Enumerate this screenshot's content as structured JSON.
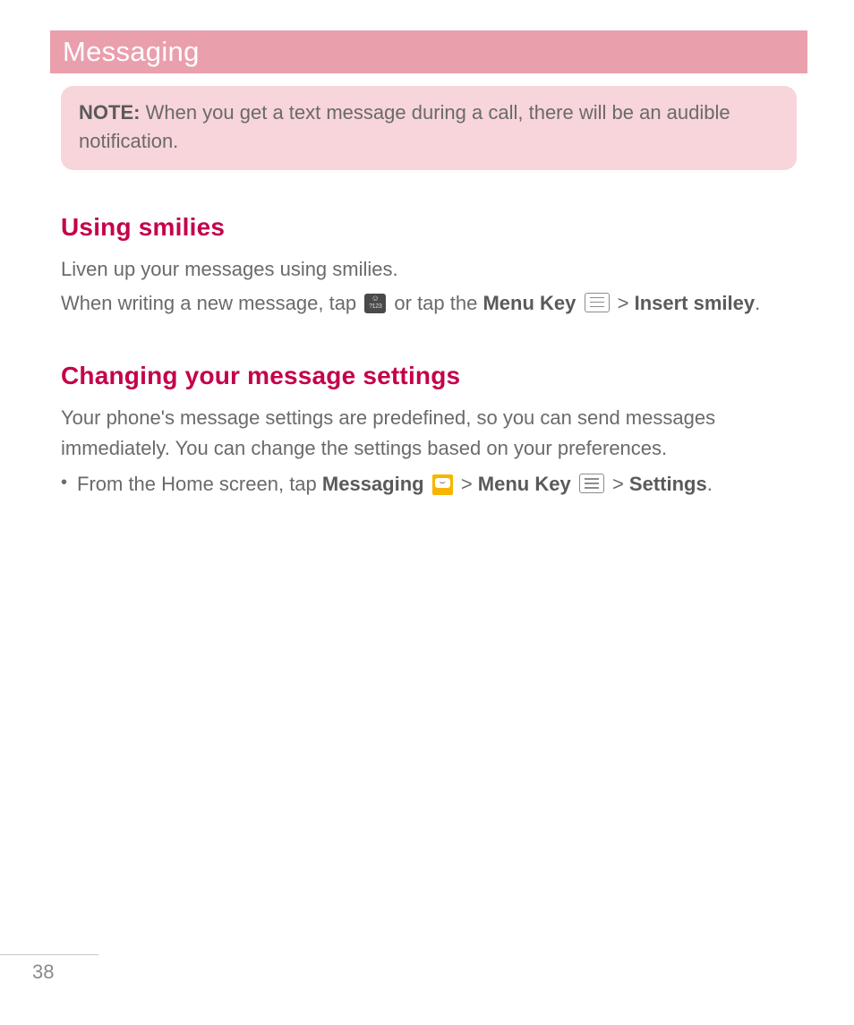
{
  "header": {
    "title": "Messaging"
  },
  "note": {
    "label": "NOTE:",
    "text": "When you get a text message during a call, there will be an audible notification."
  },
  "section1": {
    "heading": "Using smilies",
    "p1": "Liven up your messages using smilies.",
    "p2_a": "When writing a new message, tap ",
    "p2_b": " or tap the ",
    "p2_menu_key": "Menu Key",
    "p2_sep": " > ",
    "p2_insert": "Insert smiley",
    "p2_end": "."
  },
  "section2": {
    "heading": "Changing your message settings",
    "p1": "Your phone's message settings are predefined, so you can send messages immediately. You can change the settings based on your preferences.",
    "bullet1_a": "From the Home screen, tap ",
    "bullet1_messaging": "Messaging",
    "bullet1_sep1": " > ",
    "bullet1_menu_key": "Menu Key",
    "bullet1_sep2": " > ",
    "bullet1_settings": "Settings",
    "bullet1_end": "."
  },
  "footer": {
    "page_number": "38"
  }
}
